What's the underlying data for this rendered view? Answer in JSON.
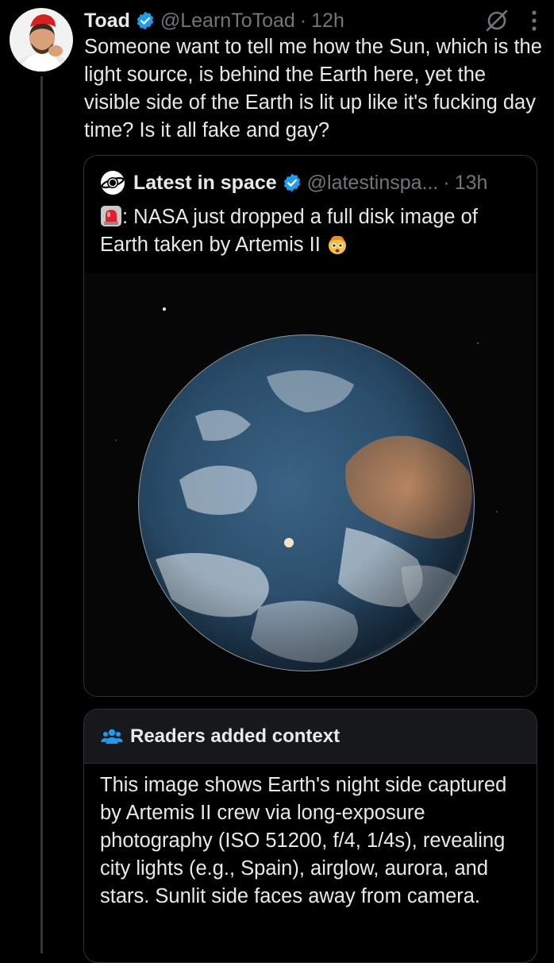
{
  "tweet": {
    "author_name": "Toad",
    "handle": "@LearnToToad",
    "separator": "·",
    "time": "12h",
    "text": "Someone want to tell me how the Sun, which is the light source, is behind the Earth here, yet the visible side of the Earth is lit up like it's fucking day time? Is it all fake and gay?"
  },
  "quote": {
    "author_name": "Latest in space",
    "handle": "@latestinspa...",
    "separator": "·",
    "time": "13h",
    "text_prefix": ": NASA just dropped a full disk image of Earth taken by Artemis II"
  },
  "context": {
    "title": "Readers added context",
    "body": "This image shows Earth's night side captured by Artemis II crew via long-exposure photography (ISO 51200, f/4, 1/4s), revealing city lights (e.g., Spain), airglow, aurora, and stars. Sunlit side faces away from camera."
  },
  "icons": {
    "verified": "verified-badge-icon",
    "grok": "grok-slash-icon",
    "more": "more-vertical-icon",
    "siren": "siren-emoji",
    "flushed": "exploding-head-emoji",
    "community": "people-icon"
  },
  "colors": {
    "accent": "#1d9bf0",
    "muted": "#71767b",
    "text": "#e7e9ea",
    "background": "#000000",
    "context_header_bg": "#16181c"
  }
}
